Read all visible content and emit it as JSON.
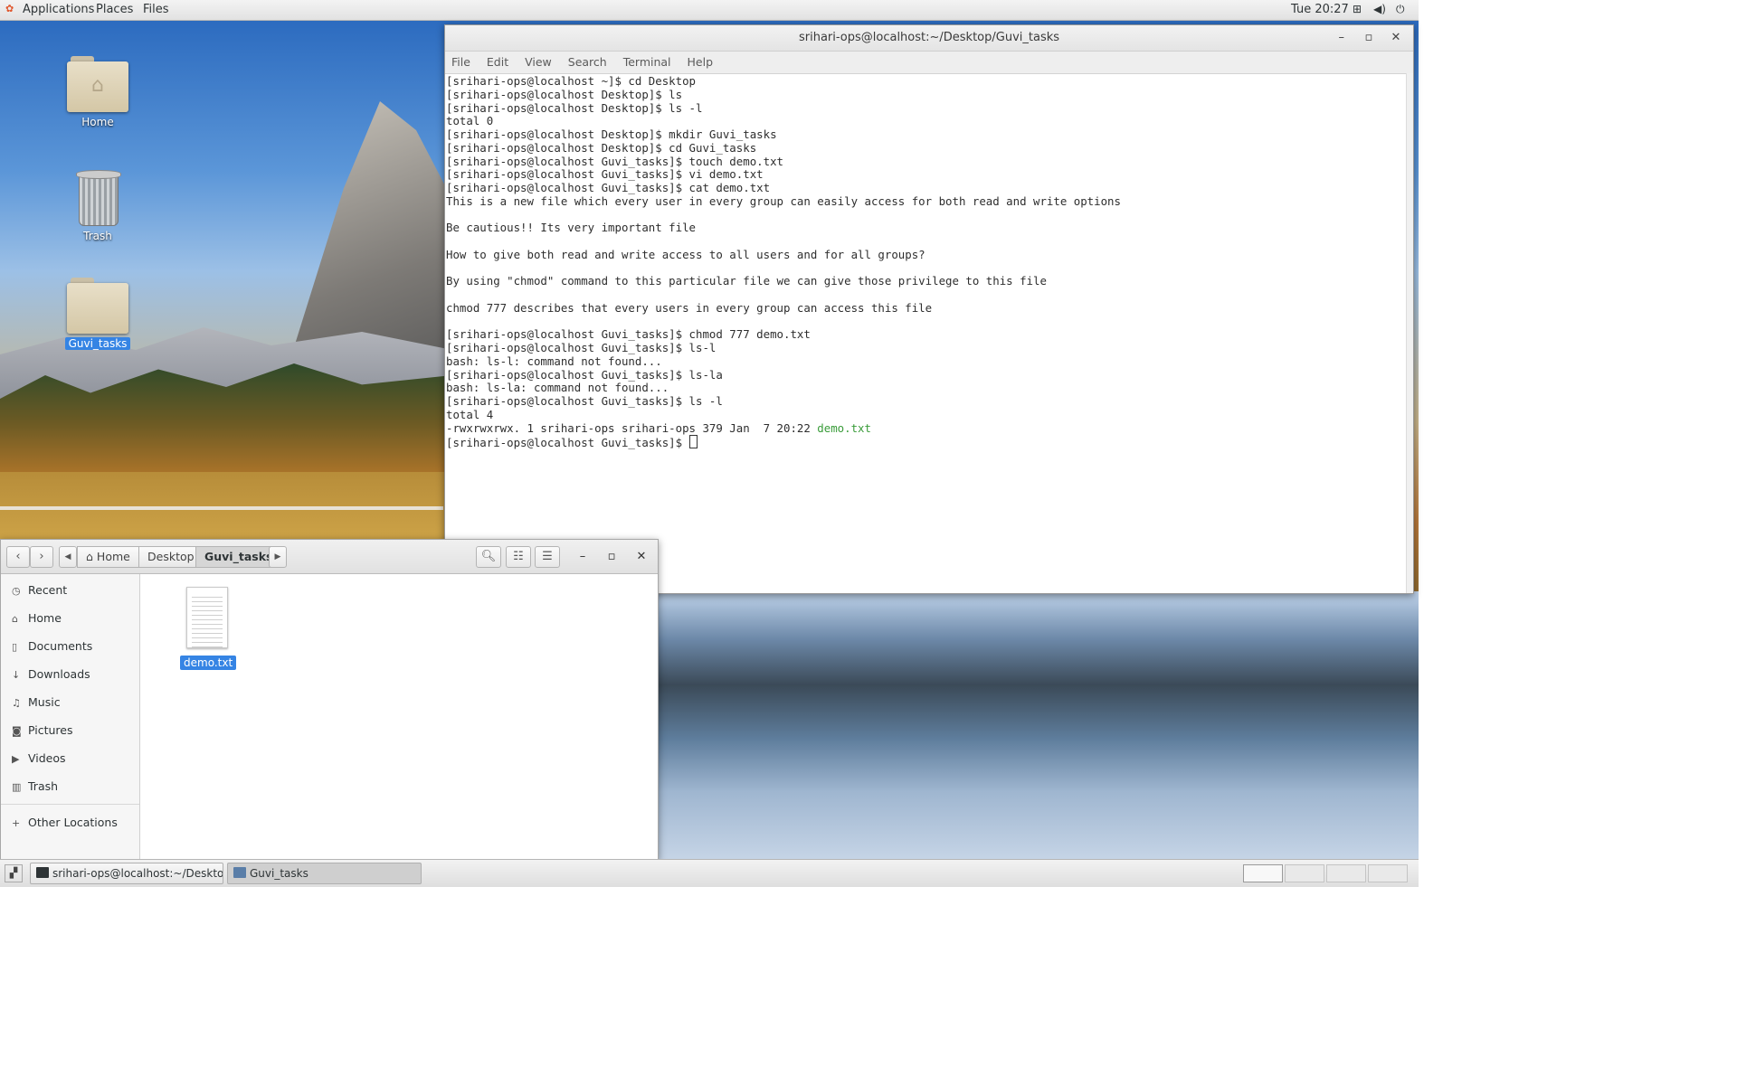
{
  "topbar": {
    "applications": "Applications",
    "places": "Places",
    "files": "Files",
    "clock": "Tue 20:27"
  },
  "desktop": {
    "icons": [
      {
        "label": "Home"
      },
      {
        "label": "Trash"
      },
      {
        "label": "Guvi_tasks"
      }
    ]
  },
  "terminal": {
    "title": "srihari-ops@localhost:~/Desktop/Guvi_tasks",
    "menu": [
      "File",
      "Edit",
      "View",
      "Search",
      "Terminal",
      "Help"
    ],
    "lines": [
      "[srihari-ops@localhost ~]$ cd Desktop",
      "[srihari-ops@localhost Desktop]$ ls",
      "[srihari-ops@localhost Desktop]$ ls -l",
      "total 0",
      "[srihari-ops@localhost Desktop]$ mkdir Guvi_tasks",
      "[srihari-ops@localhost Desktop]$ cd Guvi_tasks",
      "[srihari-ops@localhost Guvi_tasks]$ touch demo.txt",
      "[srihari-ops@localhost Guvi_tasks]$ vi demo.txt",
      "[srihari-ops@localhost Guvi_tasks]$ cat demo.txt",
      "This is a new file which every user in every group can easily access for both read and write options",
      "",
      "Be cautious!! Its very important file",
      "",
      "How to give both read and write access to all users and for all groups?",
      "",
      "By using \"chmod\" command to this particular file we can give those privilege to this file",
      "",
      "chmod 777 describes that every users in every group can access this file",
      "",
      "[srihari-ops@localhost Guvi_tasks]$ chmod 777 demo.txt",
      "[srihari-ops@localhost Guvi_tasks]$ ls-l",
      "bash: ls-l: command not found...",
      "[srihari-ops@localhost Guvi_tasks]$ ls-la",
      "bash: ls-la: command not found...",
      "[srihari-ops@localhost Guvi_tasks]$ ls -l",
      "total 4"
    ],
    "listing_prefix": "-rwxrwxrwx. 1 srihari-ops srihari-ops 379 Jan  7 20:22 ",
    "listing_file": "demo.txt",
    "prompt": "[srihari-ops@localhost Guvi_tasks]$ "
  },
  "files": {
    "breadcrumbs": [
      "Home",
      "Desktop",
      "Guvi_tasks"
    ],
    "sidebar": [
      {
        "label": "Recent",
        "icon": "clock-icon"
      },
      {
        "label": "Home",
        "icon": "home-icon"
      },
      {
        "label": "Documents",
        "icon": "document-icon"
      },
      {
        "label": "Downloads",
        "icon": "download-icon"
      },
      {
        "label": "Music",
        "icon": "music-icon"
      },
      {
        "label": "Pictures",
        "icon": "camera-icon"
      },
      {
        "label": "Videos",
        "icon": "video-icon"
      },
      {
        "label": "Trash",
        "icon": "trash-icon"
      },
      {
        "label": "Other Locations",
        "icon": "plus-icon"
      }
    ],
    "items": [
      {
        "label": "demo.txt"
      }
    ]
  },
  "taskbar": {
    "tasks": [
      {
        "label": "srihari-ops@localhost:~/Desktop/Gu..."
      },
      {
        "label": "Guvi_tasks"
      }
    ]
  },
  "colors": {
    "selection": "#3584e4",
    "terminal_exec_file": "#3a9c3a"
  }
}
